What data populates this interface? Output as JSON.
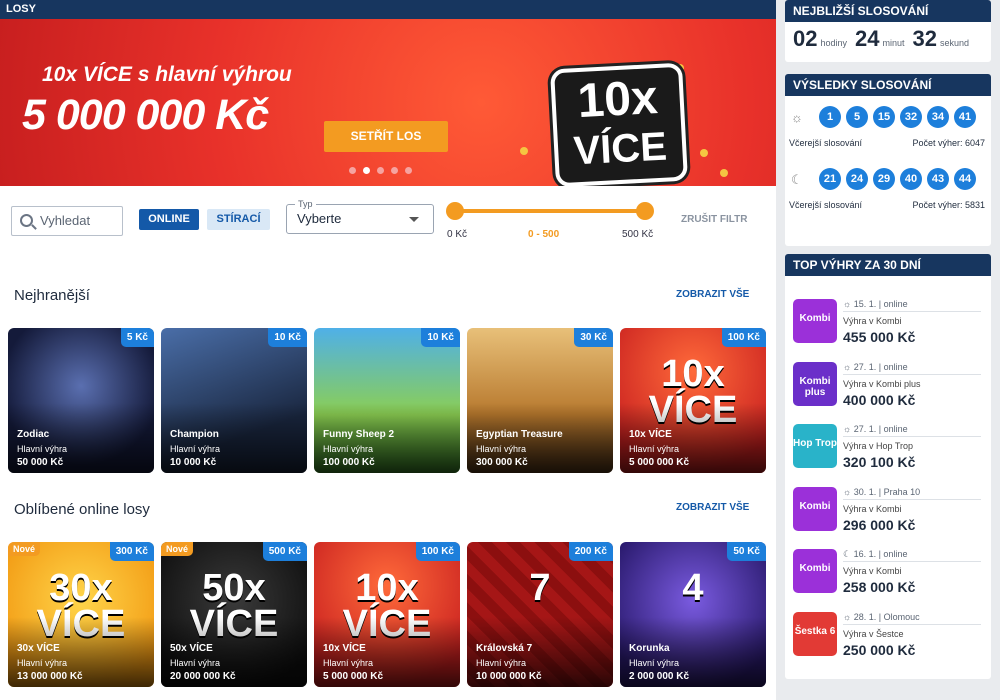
{
  "topbar": {
    "title": "LOSY"
  },
  "banner": {
    "line1": "10x VÍCE s hlavní výhrou",
    "line2": "5 000 000 Kč",
    "button": "SETŘÍT LOS",
    "badge_top": "10x",
    "badge_bottom": "VÍCE",
    "slides": 5,
    "active_slide": 2
  },
  "filters": {
    "search_placeholder": "Vyhledat",
    "online_label": "ONLINE",
    "stiraci_label": "STÍRACÍ",
    "type_label": "Typ",
    "type_value": "Vyberte",
    "price_min": "0 Kč",
    "price_range": "0 - 500",
    "price_max": "500 Kč",
    "clear_label": "ZRUŠIT FILTR"
  },
  "sections": [
    {
      "title": "Nejhranější",
      "show_all": "ZOBRAZIT VŠE",
      "cards": [
        {
          "name": "Zodiac",
          "label": "Hlavní výhra",
          "amount": "50 000 Kč",
          "price": "5 Kč",
          "new": ""
        },
        {
          "name": "Champion",
          "label": "Hlavní výhra",
          "amount": "10 000 Kč",
          "price": "10 Kč",
          "new": ""
        },
        {
          "name": "Funny Sheep 2",
          "label": "Hlavní výhra",
          "amount": "100 000 Kč",
          "price": "10 Kč",
          "new": ""
        },
        {
          "name": "Egyptian Treasure",
          "label": "Hlavní výhra",
          "amount": "300 000 Kč",
          "price": "30 Kč",
          "new": ""
        },
        {
          "name": "10x VÍCE",
          "label": "Hlavní výhra",
          "amount": "5 000 000 Kč",
          "price": "100 Kč",
          "new": ""
        }
      ]
    },
    {
      "title": "Oblíbené online losy",
      "show_all": "ZOBRAZIT VŠE",
      "cards": [
        {
          "name": "30x VÍCE",
          "label": "Hlavní výhra",
          "amount": "13 000 000 Kč",
          "price": "300 Kč",
          "new": "Nové"
        },
        {
          "name": "50x VÍCE",
          "label": "Hlavní výhra",
          "amount": "20 000 000 Kč",
          "price": "500 Kč",
          "new": "Nové"
        },
        {
          "name": "10x VÍCE",
          "label": "Hlavní výhra",
          "amount": "5 000 000 Kč",
          "price": "100 Kč",
          "new": ""
        },
        {
          "name": "Královská 7",
          "label": "Hlavní výhra",
          "amount": "10 000 000 Kč",
          "price": "200 Kč",
          "new": ""
        },
        {
          "name": "Korunka",
          "label": "Hlavní výhra",
          "amount": "2 000 000 Kč",
          "price": "50 Kč",
          "new": ""
        }
      ]
    }
  ],
  "art": [
    "",
    "",
    "",
    "",
    "10x VÍCE",
    "30x VÍCE",
    "50x VÍCE",
    "10x VÍCE",
    "7",
    "4"
  ],
  "countdown": {
    "title": "NEJBLIŽŠÍ SLOSOVÁNÍ",
    "hours": "02",
    "hours_label": "hodiny",
    "minutes": "24",
    "minutes_label": "minut",
    "seconds": "32",
    "seconds_label": "sekund"
  },
  "results": {
    "title": "VÝSLEDKY SLOSOVÁNÍ",
    "draws": [
      {
        "icon": "sun-icon",
        "numbers": [
          "1",
          "5",
          "15",
          "32",
          "34",
          "41"
        ],
        "label": "Včerejší slosování",
        "wins": "Počet výher: 6047"
      },
      {
        "icon": "moon-icon",
        "numbers": [
          "21",
          "24",
          "29",
          "40",
          "43",
          "44"
        ],
        "label": "Včerejší slosování",
        "wins": "Počet výher: 5831"
      }
    ]
  },
  "top": {
    "title": "TOP VÝHRY ZA 30 DNÍ",
    "wins": [
      {
        "logo": "Kombi",
        "meta": "☼ 15. 1. | online",
        "desc": "Výhra v Kombi",
        "amount": "455 000 Kč",
        "color": "#9b30d9"
      },
      {
        "logo": "Kombi plus",
        "meta": "☼ 27. 1. | online",
        "desc": "Výhra v Kombi plus",
        "amount": "400 000 Kč",
        "color": "#6b2fc9"
      },
      {
        "logo": "Hop Trop",
        "meta": "☼ 27. 1. | online",
        "desc": "Výhra v Hop Trop",
        "amount": "320 100 Kč",
        "color": "#29b3c9"
      },
      {
        "logo": "Kombi",
        "meta": "☼ 30. 1. | Praha 10",
        "desc": "Výhra v Kombi",
        "amount": "296 000 Kč",
        "color": "#9b30d9"
      },
      {
        "logo": "Kombi",
        "meta": "☾ 16. 1. | online",
        "desc": "Výhra v Kombi",
        "amount": "258 000 Kč",
        "color": "#9b30d9"
      },
      {
        "logo": "Šestka 6",
        "meta": "☼ 28. 1. | Olomouc",
        "desc": "Výhra v Šestce",
        "amount": "250 000 Kč",
        "color": "#e23a35"
      }
    ]
  }
}
